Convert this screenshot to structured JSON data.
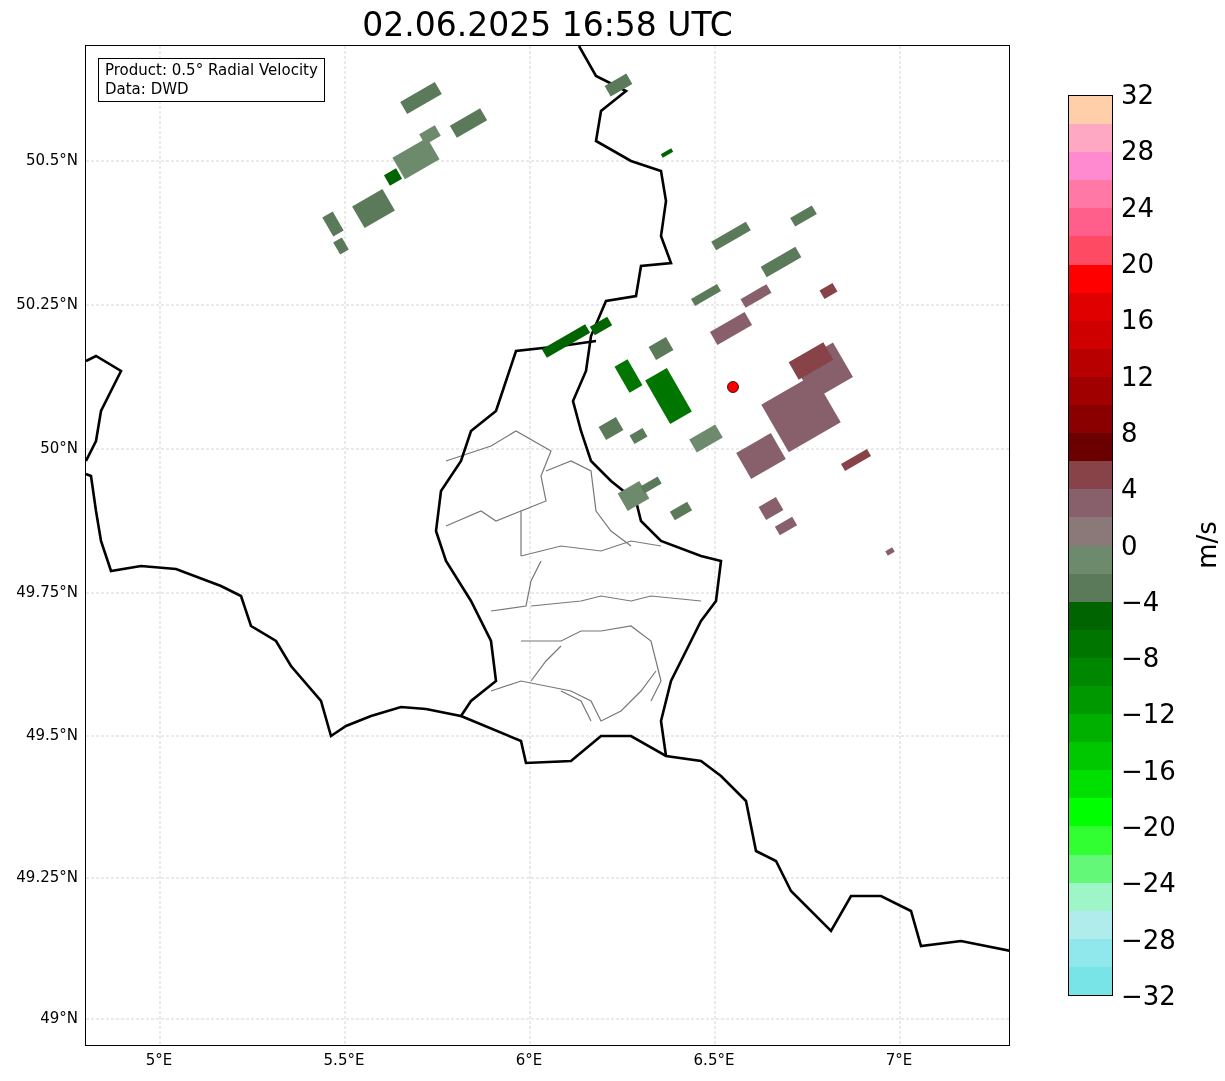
{
  "title": "02.06.2025 16:58 UTC",
  "legend": [
    "Product: 0.5° Radial Velocity",
    "Data: DWD"
  ],
  "map": {
    "lat_ticks": [
      "50.5°N",
      "50.25°N",
      "50°N",
      "49.75°N",
      "49.5°N",
      "49.25°N",
      "49°N"
    ],
    "lon_ticks": [
      "5°E",
      "5.5°E",
      "6°E",
      "6.5°E",
      "7°E"
    ]
  },
  "colorbar": {
    "label": "m/s",
    "ticks": [
      "32",
      "28",
      "24",
      "20",
      "16",
      "12",
      "8",
      "4",
      "0",
      "−4",
      "−8",
      "−12",
      "−16",
      "−20",
      "−24",
      "−28",
      "−32"
    ],
    "bands": [
      {
        "color": "#ffcfa9"
      },
      {
        "color": "#ffa8c3"
      },
      {
        "color": "#ff8ad0"
      },
      {
        "color": "#ff78a6"
      },
      {
        "color": "#ff5f8a"
      },
      {
        "color": "#ff4a63"
      },
      {
        "color": "#ff0000"
      },
      {
        "color": "#e00000"
      },
      {
        "color": "#d10000"
      },
      {
        "color": "#b80000"
      },
      {
        "color": "#a00000"
      },
      {
        "color": "#8a0000"
      },
      {
        "color": "#6b0000"
      },
      {
        "color": "#874348"
      },
      {
        "color": "#88606c"
      },
      {
        "color": "#8b7878"
      },
      {
        "color": "#6d8a6d"
      },
      {
        "color": "#5a7a5a"
      },
      {
        "color": "#006400"
      },
      {
        "color": "#007500"
      },
      {
        "color": "#008700"
      },
      {
        "color": "#009800"
      },
      {
        "color": "#00b000"
      },
      {
        "color": "#00c800"
      },
      {
        "color": "#00e000"
      },
      {
        "color": "#00ff00"
      },
      {
        "color": "#32ff32"
      },
      {
        "color": "#64f878"
      },
      {
        "color": "#9ef5c8"
      },
      {
        "color": "#b0ecec"
      },
      {
        "color": "#90e8ec"
      },
      {
        "color": "#78e4e8"
      }
    ]
  }
}
